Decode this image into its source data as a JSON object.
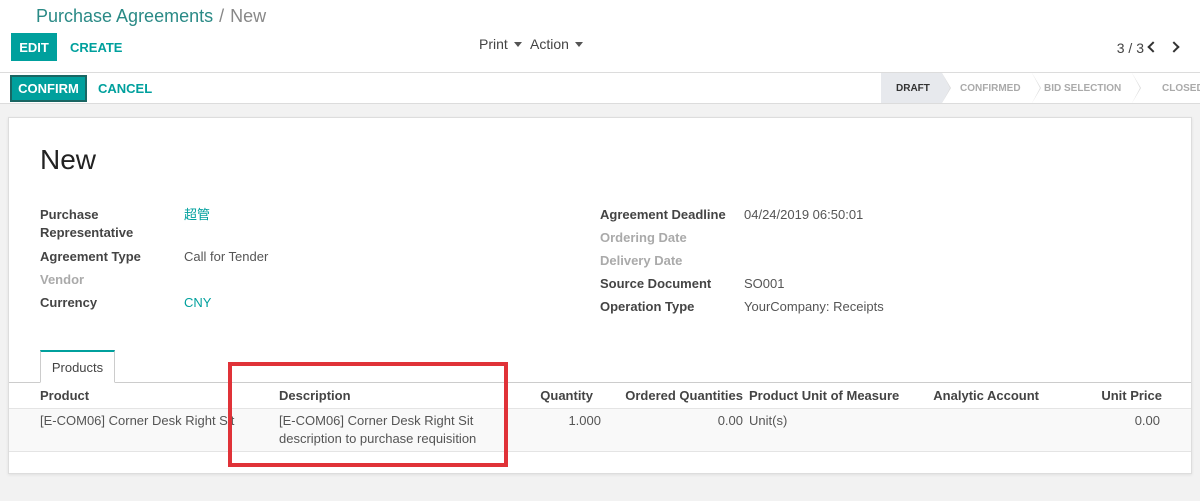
{
  "breadcrumb": {
    "parent": "Purchase Agreements",
    "separator": "/",
    "current": "New"
  },
  "toolbar": {
    "edit_label": "EDIT",
    "create_label": "CREATE",
    "print_label": "Print",
    "action_label": "Action"
  },
  "pager": {
    "value": "3 / 3"
  },
  "statusbar": {
    "confirm_label": "CONFIRM",
    "cancel_label": "CANCEL",
    "stages": [
      "DRAFT",
      "CONFIRMED",
      "BID SELECTION",
      "CLOSED"
    ],
    "active_stage": "DRAFT"
  },
  "form": {
    "title": "New",
    "left_fields": [
      {
        "label": "Purchase Representative",
        "value": "超管",
        "is_link": true
      },
      {
        "label": "Agreement Type",
        "value": "Call for Tender"
      },
      {
        "label": "Vendor",
        "value": ""
      },
      {
        "label": "Currency",
        "value": "CNY",
        "is_link": true
      }
    ],
    "right_fields": [
      {
        "label": "Agreement Deadline",
        "value": "04/24/2019 06:50:01"
      },
      {
        "label": "Ordering Date",
        "value": ""
      },
      {
        "label": "Delivery Date",
        "value": ""
      },
      {
        "label": "Source Document",
        "value": "SO001"
      },
      {
        "label": "Operation Type",
        "value": "YourCompany: Receipts"
      }
    ]
  },
  "tabs": [
    {
      "label": "Products",
      "active": true
    }
  ],
  "table": {
    "columns": [
      "Product",
      "Description",
      "Quantity",
      "Ordered Quantities",
      "Product Unit of Measure",
      "Analytic Account",
      "Unit Price"
    ],
    "rows": [
      {
        "product": "[E-COM06] Corner Desk Right Sit",
        "description_line1": "[E-COM06] Corner Desk Right Sit",
        "description_line2": "description to purchase requisition",
        "quantity": "1.000",
        "ordered_quantities": "0.00",
        "uom": "Unit(s)",
        "analytic_account": "",
        "unit_price": "0.00"
      }
    ]
  },
  "colors": {
    "accent": "#00a09d",
    "link": "#2a8a86",
    "highlight": "#e03238",
    "muted": "#aaaaaa"
  }
}
